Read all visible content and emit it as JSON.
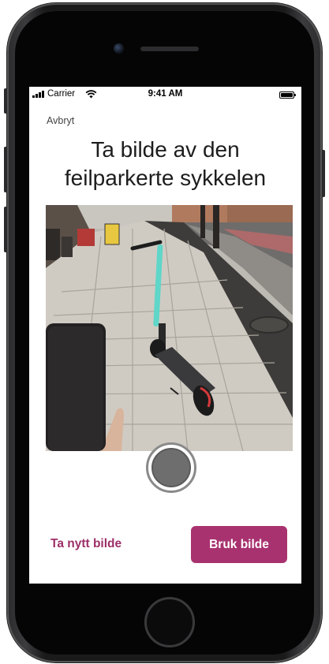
{
  "status_bar": {
    "carrier": "Carrier",
    "time": "9:41 AM",
    "signal_icon": "cellular-signal-icon",
    "wifi_icon": "wifi-icon",
    "battery_icon": "battery-icon",
    "battery_level": 1.0
  },
  "header": {
    "cancel_label": "Avbryt",
    "title": "Ta bilde av den feilparkerte sykkelen"
  },
  "preview": {
    "subject": "photo of an e-scooter parked on a sidewalk"
  },
  "camera": {
    "shutter_icon": "shutter-button-icon"
  },
  "actions": {
    "retake_label": "Ta nytt bilde",
    "use_label": "Bruk bilde"
  },
  "colors": {
    "accent": "#a8326f",
    "accent_text": "#9c2f68",
    "title_text": "#1d1d1d",
    "frame": "#1a1a1b"
  }
}
